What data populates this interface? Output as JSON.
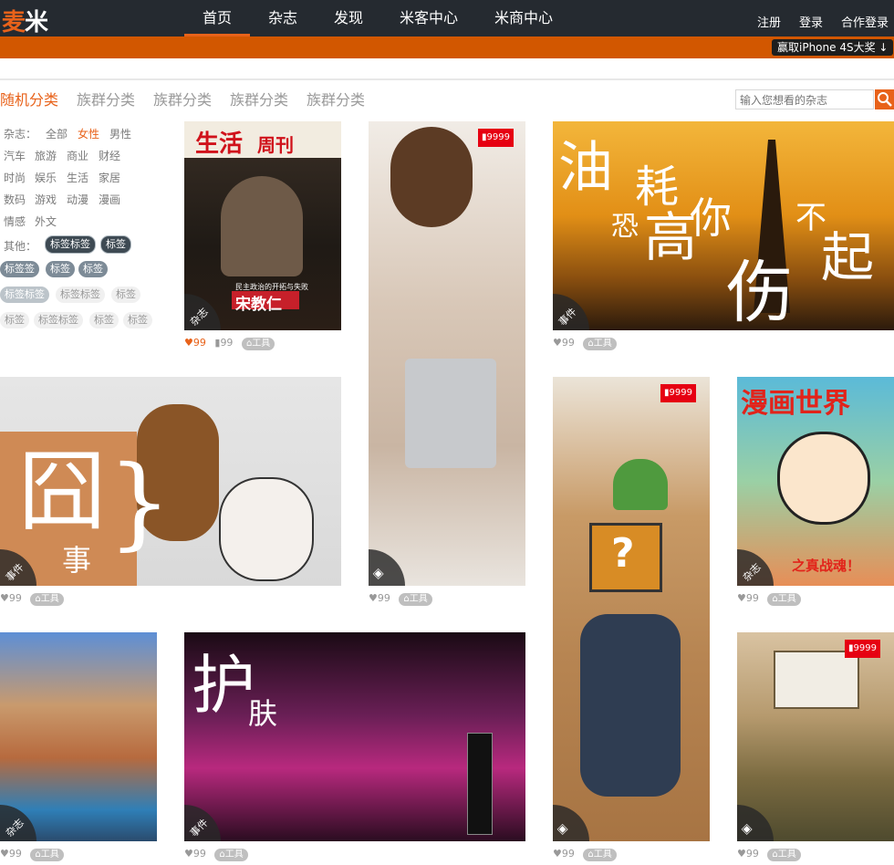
{
  "header": {
    "logo_a": "麦",
    "logo_b": "米",
    "nav": [
      "首页",
      "杂志",
      "发现",
      "米客中心",
      "米商中心"
    ],
    "right_links": [
      "注册",
      "登录",
      "合作登录"
    ],
    "promo": "赢取iPhone 4S大奖"
  },
  "colors": {
    "accent": "#e8621a",
    "topbar": "#252a30",
    "orange_bar": "#d25700"
  },
  "categories": {
    "tabs": [
      "随机分类",
      "族群分类",
      "族群分类",
      "族群分类",
      "族群分类"
    ],
    "active": 0
  },
  "search": {
    "placeholder": "输入您想看的杂志",
    "icon": "search-icon"
  },
  "filters": {
    "mag_label": "杂志：",
    "row1": [
      "全部",
      "女性",
      "男性"
    ],
    "row2": [
      "汽车",
      "旅游",
      "商业",
      "财经"
    ],
    "row3": [
      "时尚",
      "娱乐",
      "生活",
      "家居"
    ],
    "row4": [
      "数码",
      "游戏",
      "动漫",
      "漫画"
    ],
    "row5": [
      "情感",
      "外文"
    ],
    "other_label": "其他：",
    "tags_a": [
      "标签标签",
      "标签"
    ],
    "tags_b": [
      "标签签",
      "标签",
      "标签"
    ],
    "tags_c": [
      "标签标签",
      "标签标签",
      "标签"
    ],
    "tags_d": [
      "标签",
      "标签标签",
      "标签",
      "标签"
    ]
  },
  "cards": [
    {
      "type": "杂志",
      "title_l": "生活",
      "title_r": "周刊",
      "caption": "宋教仁",
      "subcap": "民主政治的开拓与失败",
      "likes": "99",
      "views": "99",
      "tool": "工具"
    },
    {
      "badge": "9999",
      "type_icon": "photo-icon",
      "likes": "99",
      "tool": "工具"
    },
    {
      "type": "事件",
      "t1": "油",
      "t2": "耗",
      "t3": "恐",
      "t4": "高",
      "t5": "你",
      "t6": "伤",
      "t7": "不",
      "t8": "起",
      "likes": "99",
      "tool": "工具"
    },
    {
      "type": "事件",
      "t1": "囧",
      "t2": "事",
      "likes": "99",
      "tool": "工具"
    },
    {
      "badge": "9999",
      "type_icon": "photo-icon",
      "likes": "99",
      "tool": "工具"
    },
    {
      "type": "杂志",
      "title": "漫画世界",
      "sub": "之真战魂！",
      "likes": "99",
      "tool": "工具"
    },
    {
      "type": "杂志",
      "likes": "99",
      "tool": "工具"
    },
    {
      "type": "事件",
      "t1": "护",
      "t2": "肤",
      "likes": "99",
      "tool": "工具"
    },
    {
      "badge": "9999",
      "type_icon": "photo-icon",
      "likes": "99",
      "tool": "工具"
    }
  ]
}
